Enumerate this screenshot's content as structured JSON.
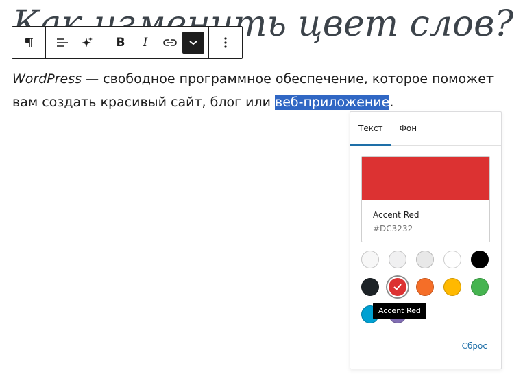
{
  "heading": "Как изменить цвет слов?",
  "toolbar": {
    "bold": "B",
    "italic": "I"
  },
  "paragraph": {
    "italic_part": "WordPress",
    "text_part": " — свободное программное обеспечение, которое поможет вам создать красивый сайт, блог или ",
    "selected_part": "веб-приложение",
    "end_part": "."
  },
  "popover": {
    "tabs": [
      "Текст",
      "Фон"
    ],
    "active_tab": "Текст",
    "current_color": {
      "name": "Accent Red",
      "hex": "#DC3232"
    },
    "palette": [
      {
        "name": "white-1",
        "hex": "#F7F7F7"
      },
      {
        "name": "white-2",
        "hex": "#F0F0F1"
      },
      {
        "name": "white-3",
        "hex": "#E8E8E8"
      },
      {
        "name": "white-4",
        "hex": "#FFFFFF"
      },
      {
        "name": "black",
        "hex": "#000000"
      },
      {
        "name": "dark",
        "hex": "#1D2327"
      },
      {
        "name": "accent-red",
        "hex": "#DC3232"
      },
      {
        "name": "orange",
        "hex": "#F56E28"
      },
      {
        "name": "yellow",
        "hex": "#FFB900"
      },
      {
        "name": "green",
        "hex": "#46B450"
      },
      {
        "name": "blue",
        "hex": "#00A0D2"
      },
      {
        "name": "purple",
        "hex": "#826EB4"
      }
    ],
    "tooltip": "Accent Red",
    "reset_label": "Сброс"
  },
  "colors": {
    "selection": "#3067C4",
    "link": "#1E6FA8",
    "toolbar_border": "#1E1E1E"
  }
}
